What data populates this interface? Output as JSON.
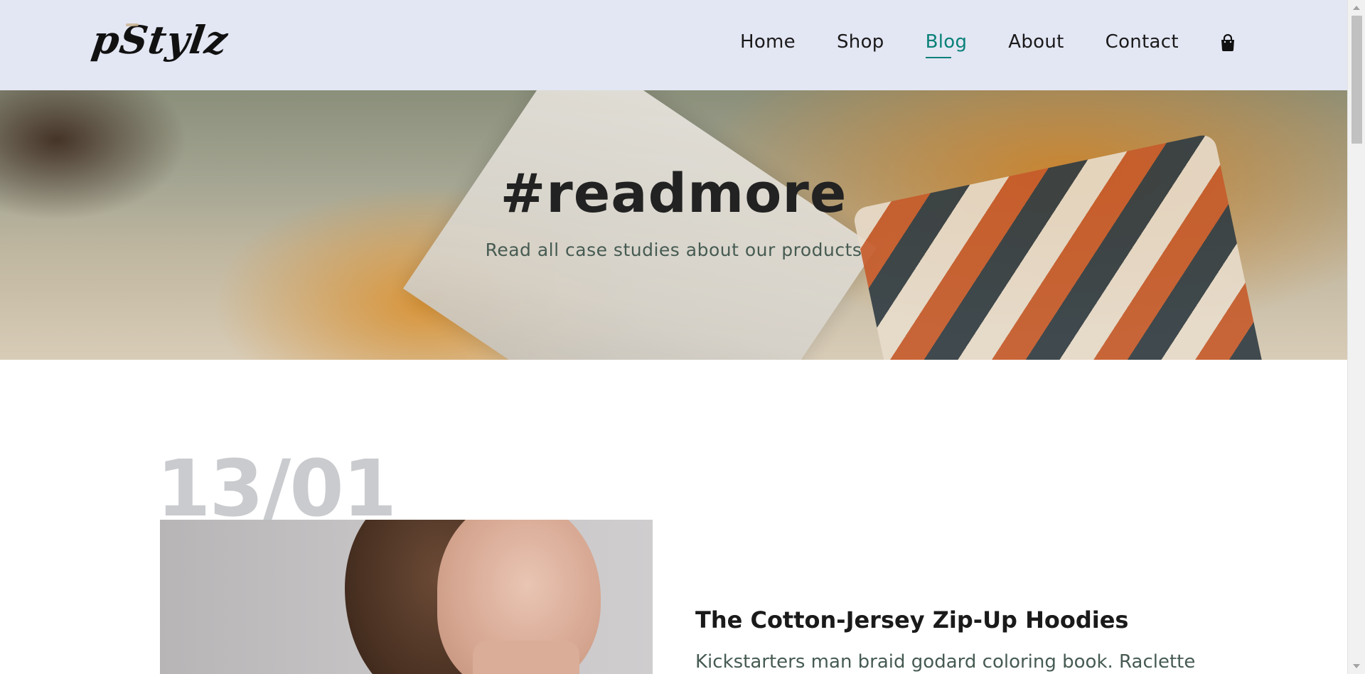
{
  "header": {
    "logo_text": "pStylz",
    "nav": [
      {
        "label": "Home",
        "active": false
      },
      {
        "label": "Shop",
        "active": false
      },
      {
        "label": "Blog",
        "active": true
      },
      {
        "label": "About",
        "active": false
      },
      {
        "label": "Contact",
        "active": false
      }
    ],
    "cart_icon": "shopping-bag-icon"
  },
  "hero": {
    "title": "#readmore",
    "subtitle": "Read all case studies about our products"
  },
  "blog": {
    "posts": [
      {
        "date": "13/01",
        "title": "The Cotton-Jersey Zip-Up Hoodies",
        "excerpt": "Kickstarters man braid godard coloring book. Raclette"
      }
    ]
  },
  "colors": {
    "accent": "#088178",
    "header_bg": "#e3e6f3",
    "date_color": "#c9cbce",
    "text_muted": "#465b52"
  }
}
